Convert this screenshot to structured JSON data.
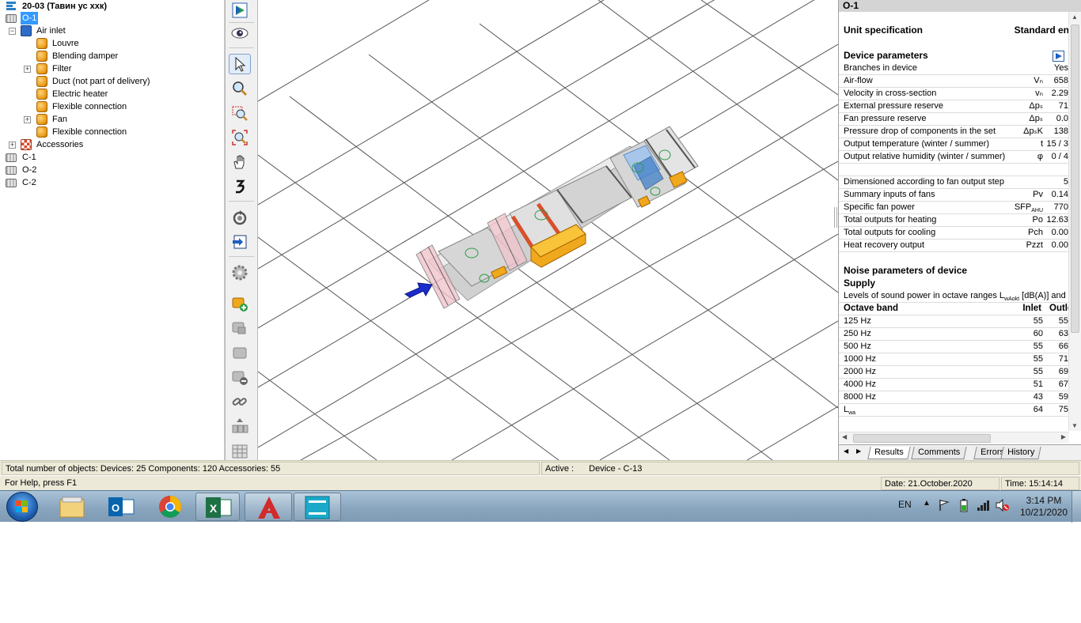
{
  "tree": {
    "project_label": "20-03 (Тавин ус ххк)",
    "nodes": [
      {
        "label": "O-1",
        "icon": "device-icon",
        "selected": true
      },
      {
        "label": "Air inlet",
        "icon": "air-inlet-icon"
      },
      {
        "label": "Louvre",
        "icon": "component-icon"
      },
      {
        "label": "Blending damper",
        "icon": "component-icon"
      },
      {
        "label": "Filter",
        "icon": "component-icon"
      },
      {
        "label": "Duct (not part of delivery)",
        "icon": "component-icon"
      },
      {
        "label": "Electric heater",
        "icon": "component-icon"
      },
      {
        "label": "Flexible connection",
        "icon": "component-icon"
      },
      {
        "label": "Fan",
        "icon": "component-icon"
      },
      {
        "label": "Flexible connection",
        "icon": "component-icon"
      },
      {
        "label": "Accessories",
        "icon": "accessories-icon"
      },
      {
        "label": "C-1",
        "icon": "device-icon"
      },
      {
        "label": "O-2",
        "icon": "device-icon"
      },
      {
        "label": "C-2",
        "icon": "device-icon"
      }
    ]
  },
  "toolbar": {
    "icons": [
      "play-icon",
      "eye-icon",
      "pointer-icon",
      "zoom-icon",
      "zoom-window-icon",
      "zoom-extents-icon",
      "pan-hand-icon",
      "reverse-icon",
      "rotate-icon",
      "import-icon",
      "settings-gear-icon",
      "add-component-icon",
      "component-icon",
      "component-icon",
      "remove-component-icon",
      "link-icon",
      "insert-icon",
      "grid-icon"
    ]
  },
  "results": {
    "title": "O-1",
    "unit_spec_label": "Unit specification",
    "unit_spec_value": "Standard en",
    "device_params_label": "Device parameters",
    "params": [
      {
        "label": "Branches in device",
        "symbol": "",
        "value": "Yes"
      },
      {
        "label": "Air-flow",
        "symbol": "Vₙ",
        "value": "658"
      },
      {
        "label": "Velocity in cross-section",
        "symbol": "vₙ",
        "value": "2.29"
      },
      {
        "label": "External pressure reserve",
        "symbol": "Δpₛ",
        "value": "71"
      },
      {
        "label": "Fan pressure reserve",
        "symbol": "Δpₛ",
        "value": "0.0"
      },
      {
        "label": "Pressure drop of components in the set",
        "symbol": "ΔpₛK",
        "value": "138"
      },
      {
        "label": "Output temperature (winter / summer)",
        "symbol": "t",
        "value": "15 / 3"
      },
      {
        "label": "Output relative humidity (winter / summer)",
        "symbol": "φ",
        "value": "0 / 4"
      },
      {
        "label": "",
        "symbol": "",
        "value": ""
      },
      {
        "label": "Dimensioned according to fan output step",
        "symbol": "",
        "value": "5"
      },
      {
        "label": "Summary inputs of fans",
        "symbol": "Pv",
        "value": "0.14"
      },
      {
        "label": "Specific fan power",
        "symbol": "SFP",
        "symbol_sub": "AHU",
        "value": "770"
      },
      {
        "label": "Total outputs for heating",
        "symbol": "Po",
        "value": "12.63"
      },
      {
        "label": "Total outputs for cooling",
        "symbol": "Pch",
        "value": "0.00"
      },
      {
        "label": "Heat recovery output",
        "symbol": "Pzzt",
        "value": "0.00"
      }
    ],
    "noise_label": "Noise parameters of device",
    "supply_label": "Supply",
    "levels_text_a": "Levels of sound power in octave ranges L",
    "levels_text_sub": "wAokt",
    "levels_text_b": " [dB(A)] and to",
    "octave_header": {
      "band": "Octave band",
      "inlet": "Inlet",
      "outlet": "Outle"
    },
    "octave_rows": [
      {
        "band": "125 Hz",
        "inlet": "55",
        "outlet": "55"
      },
      {
        "band": "250 Hz",
        "inlet": "60",
        "outlet": "63"
      },
      {
        "band": "500 Hz",
        "inlet": "55",
        "outlet": "66"
      },
      {
        "band": "1000 Hz",
        "inlet": "55",
        "outlet": "71"
      },
      {
        "band": "2000 Hz",
        "inlet": "55",
        "outlet": "69"
      },
      {
        "band": "4000 Hz",
        "inlet": "51",
        "outlet": "67"
      },
      {
        "band": "8000 Hz",
        "inlet": "43",
        "outlet": "59"
      },
      {
        "band": "L",
        "band_sub": "wa",
        "inlet": "64",
        "outlet": "75"
      }
    ],
    "tabs": [
      "Results",
      "Comments",
      "Errors",
      "History"
    ],
    "active_tab": "Results"
  },
  "status": {
    "totals": "Total number of objects: Devices: 25    Components: 120    Accessories: 55",
    "active_label": "Active :",
    "active_value": "Device - C-13",
    "help": "For Help, press F1",
    "date": "Date:  21.October.2020",
    "time": "Time:  15:14:14"
  },
  "taskbar": {
    "apps": [
      "start-orb-icon",
      "file-explorer-icon",
      "outlook-icon",
      "chrome-icon",
      "excel-icon",
      "autocad-icon",
      "hvac-app-icon"
    ],
    "lang": "EN",
    "clock_time": "3:14 PM",
    "clock_date": "10/21/2020"
  },
  "colors": {
    "selection": "#3399ff",
    "component_orange": "#f0a81c",
    "heater_red": "#d8502c",
    "airflow_arrow": "#1a2ccc",
    "taskbar": "#8aa6bf"
  }
}
